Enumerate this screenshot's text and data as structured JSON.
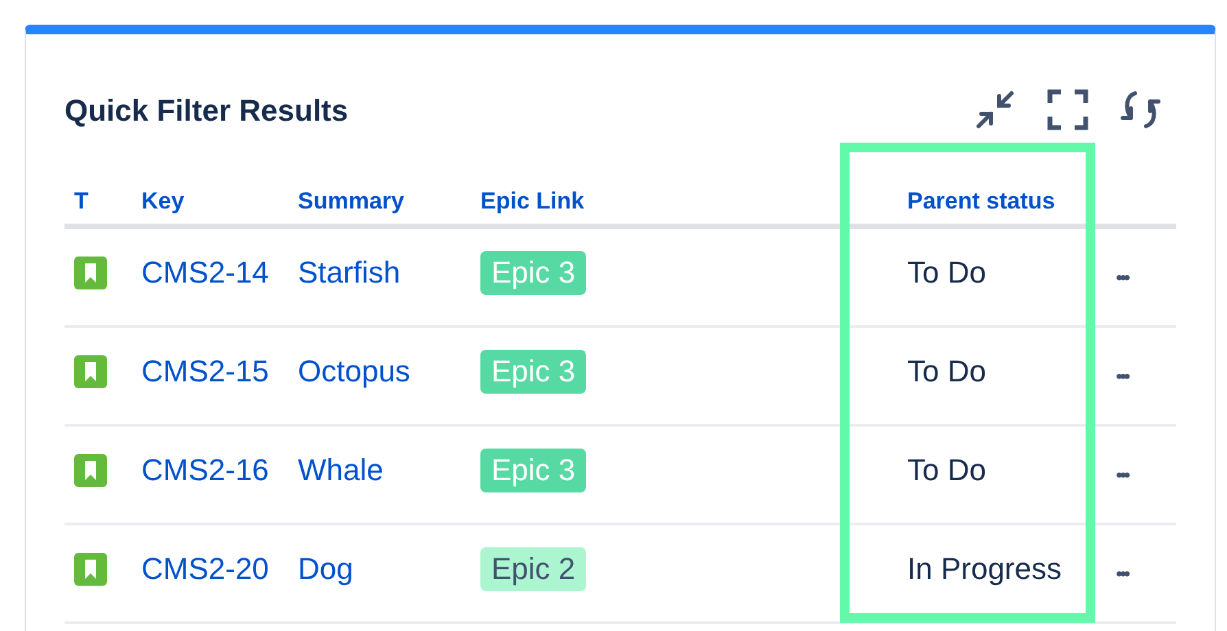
{
  "gadget": {
    "title": "Quick Filter Results"
  },
  "table": {
    "columns": [
      "T",
      "Key",
      "Summary",
      "Epic Link",
      "Parent status"
    ],
    "rows": [
      {
        "key": "CMS2-14",
        "summary": "Starfish",
        "epic": {
          "label": "Epic 3",
          "color": "#57d9a3"
        },
        "parent_status": "To Do",
        "menu": "•••"
      },
      {
        "key": "CMS2-15",
        "summary": "Octopus",
        "epic": {
          "label": "Epic 3",
          "color": "#57d9a3"
        },
        "parent_status": "To Do",
        "menu": "•••"
      },
      {
        "key": "CMS2-16",
        "summary": "Whale",
        "epic": {
          "label": "Epic 3",
          "color": "#57d9a3"
        },
        "parent_status": "To Do",
        "menu": "•••"
      },
      {
        "key": "CMS2-20",
        "summary": "Dog",
        "epic": {
          "label": "Epic 2",
          "color": "#abf5d1"
        },
        "parent_status": "In Progress",
        "menu": "•••"
      }
    ]
  }
}
